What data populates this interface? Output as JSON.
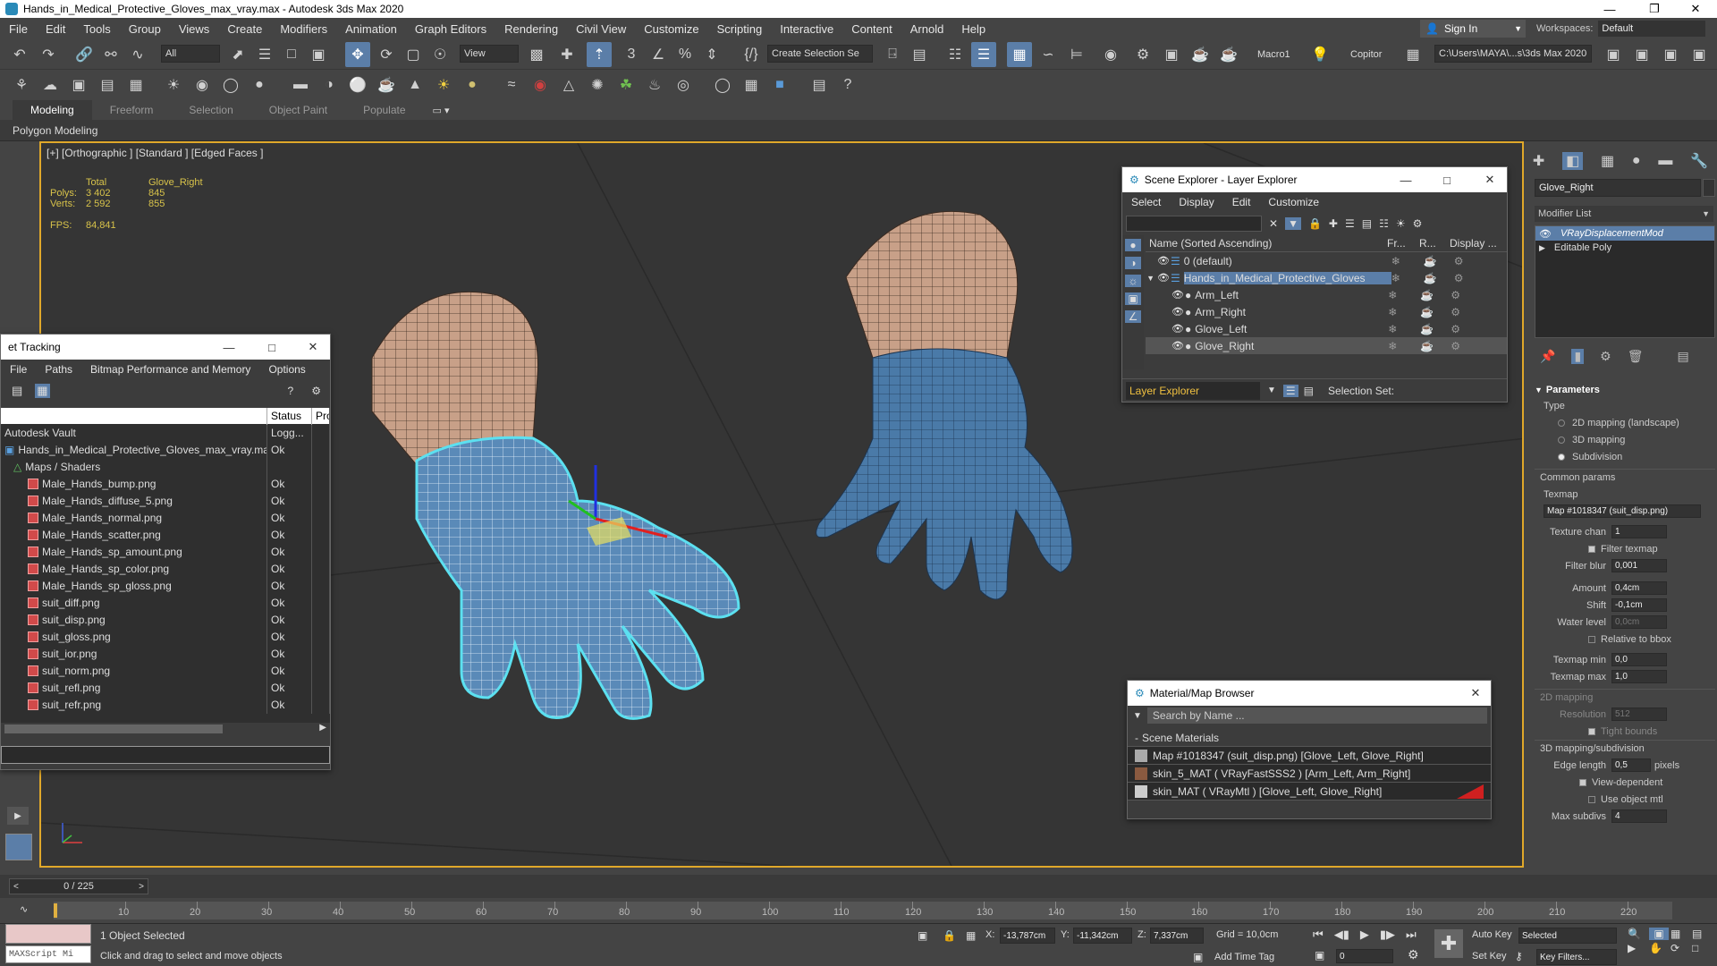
{
  "window": {
    "title": "Hands_in_Medical_Protective_Gloves_max_vray.max - Autodesk 3ds Max 2020"
  },
  "menu": [
    "File",
    "Edit",
    "Tools",
    "Group",
    "Views",
    "Create",
    "Modifiers",
    "Animation",
    "Graph Editors",
    "Rendering",
    "Civil View",
    "Customize",
    "Scripting",
    "Interactive",
    "Content",
    "Arnold",
    "Help"
  ],
  "signin": {
    "label": "Sign In"
  },
  "workspaces": {
    "label": "Workspaces:",
    "value": "Default"
  },
  "toolbar": {
    "filter": "All",
    "view": "View",
    "selection_set": "Create Selection Se",
    "macro": "Macro1",
    "copitor": "Copitor",
    "path": "C:\\Users\\MAYA\\...s\\3ds Max 2020"
  },
  "ribbon": {
    "tabs": [
      "Modeling",
      "Freeform",
      "Selection",
      "Object Paint",
      "Populate"
    ],
    "active": "Modeling",
    "subtitle": "Polygon Modeling"
  },
  "viewport": {
    "label": "[+] [Orthographic ] [Standard ] [Edged Faces ]",
    "stats": {
      "total_label": "Total",
      "obj_label": "Glove_Right",
      "polys_label": "Polys:",
      "polys_total": "3 402",
      "polys_obj": "845",
      "verts_label": "Verts:",
      "verts_total": "2 592",
      "verts_obj": "855",
      "fps_label": "FPS:",
      "fps": "84,841"
    }
  },
  "asset_tracking": {
    "title": "et Tracking",
    "menu": [
      "File",
      "Paths",
      "Bitmap Performance and Memory",
      "Options"
    ],
    "col_status": "Status",
    "col_pr": "Pro",
    "vault": "Autodesk Vault",
    "vault_status": "Logg...",
    "scene_file": "Hands_in_Medical_Protective_Gloves_max_vray.max",
    "scene_status": "Ok",
    "maps_group": "Maps / Shaders",
    "files": [
      {
        "name": "Male_Hands_bump.png",
        "status": "Ok"
      },
      {
        "name": "Male_Hands_diffuse_5.png",
        "status": "Ok"
      },
      {
        "name": "Male_Hands_normal.png",
        "status": "Ok"
      },
      {
        "name": "Male_Hands_scatter.png",
        "status": "Ok"
      },
      {
        "name": "Male_Hands_sp_amount.png",
        "status": "Ok"
      },
      {
        "name": "Male_Hands_sp_color.png",
        "status": "Ok"
      },
      {
        "name": "Male_Hands_sp_gloss.png",
        "status": "Ok"
      },
      {
        "name": "suit_diff.png",
        "status": "Ok"
      },
      {
        "name": "suit_disp.png",
        "status": "Ok"
      },
      {
        "name": "suit_gloss.png",
        "status": "Ok"
      },
      {
        "name": "suit_ior.png",
        "status": "Ok"
      },
      {
        "name": "suit_norm.png",
        "status": "Ok"
      },
      {
        "name": "suit_refl.png",
        "status": "Ok"
      },
      {
        "name": "suit_refr.png",
        "status": "Ok"
      }
    ]
  },
  "scene_explorer": {
    "title": "Scene Explorer - Layer Explorer",
    "menu": [
      "Select",
      "Display",
      "Edit",
      "Customize"
    ],
    "col_name": "Name (Sorted Ascending)",
    "col_fr": "Fr...",
    "col_r": "R...",
    "col_display": "Display ...",
    "rows": [
      {
        "name": "0 (default)",
        "indent": 0
      },
      {
        "name": "Hands_in_Medical_Protective_Gloves",
        "indent": 0
      },
      {
        "name": "Arm_Left",
        "indent": 1
      },
      {
        "name": "Arm_Right",
        "indent": 1
      },
      {
        "name": "Glove_Left",
        "indent": 1
      },
      {
        "name": "Glove_Right",
        "indent": 1
      }
    ],
    "footer_left": "Layer Explorer",
    "footer_right": "Selection Set:"
  },
  "material_browser": {
    "title": "Material/Map Browser",
    "search_placeholder": "Search by Name ...",
    "group": "Scene Materials",
    "items": [
      "Map #1018347 (suit_disp.png) [Glove_Left, Glove_Right]",
      "skin_5_MAT ( VRayFastSSS2 ) [Arm_Left, Arm_Right]",
      "skin_MAT ( VRayMtl ) [Glove_Left, Glove_Right]"
    ]
  },
  "command_panel": {
    "object_name": "Glove_Right",
    "modifier_list": "Modifier List",
    "stack": [
      "VRayDisplacementMod",
      "Editable Poly"
    ],
    "parameters": "Parameters",
    "type_label": "Type",
    "types": [
      "2D mapping (landscape)",
      "3D mapping",
      "Subdivision"
    ],
    "selected_type": "Subdivision",
    "common_params": "Common params",
    "texmap_label": "Texmap",
    "texmap_value": "Map #1018347 (suit_disp.png)",
    "texture_chan_label": "Texture chan",
    "texture_chan": "1",
    "filter_texmap": "Filter texmap",
    "filter_blur_label": "Filter blur",
    "filter_blur": "0,001",
    "amount_label": "Amount",
    "amount": "0,4cm",
    "shift_label": "Shift",
    "shift": "-0,1cm",
    "water_label": "Water level",
    "water": "0,0cm",
    "relative_bbox": "Relative to bbox",
    "texmap_min_label": "Texmap min",
    "texmap_min": "0,0",
    "texmap_max_label": "Texmap max",
    "texmap_max": "1,0",
    "mapping2d": "2D mapping",
    "resolution_label": "Resolution",
    "resolution": "512",
    "tight_bounds": "Tight bounds",
    "mapping3d": "3D mapping/subdivision",
    "edge_length_label": "Edge length",
    "edge_length": "0,5",
    "pixels": "pixels",
    "view_dependent": "View-dependent",
    "use_object_mtl": "Use object mtl",
    "max_subdivs_label": "Max subdivs",
    "max_subdivs": "4"
  },
  "timeline": {
    "frame": "0 / 225",
    "ticks": [
      "10",
      "20",
      "30",
      "40",
      "50",
      "60",
      "70",
      "80",
      "90",
      "100",
      "110",
      "120",
      "130",
      "140",
      "150",
      "160",
      "170",
      "180",
      "190",
      "200",
      "210",
      "220"
    ]
  },
  "status": {
    "maxscript": "MAXScript Mi",
    "selected": "1 Object Selected",
    "hint": "Click and drag to select and move objects",
    "x_label": "X:",
    "x": "-13,787cm",
    "y_label": "Y:",
    "y": "-11,342cm",
    "z_label": "Z:",
    "z": "7,337cm",
    "grid": "Grid = 10,0cm",
    "add_time_tag": "Add Time Tag",
    "auto_key": "Auto Key",
    "selected_dd": "Selected",
    "set_key": "Set Key",
    "key_filters": "Key Filters...",
    "frame_field": "0"
  },
  "colors": {
    "accent": "#5b7ea8",
    "viewport_border": "#e0a82a",
    "glove": "#4a7aa8",
    "skin": "#c8a088",
    "selection": "#5ce0f0"
  }
}
